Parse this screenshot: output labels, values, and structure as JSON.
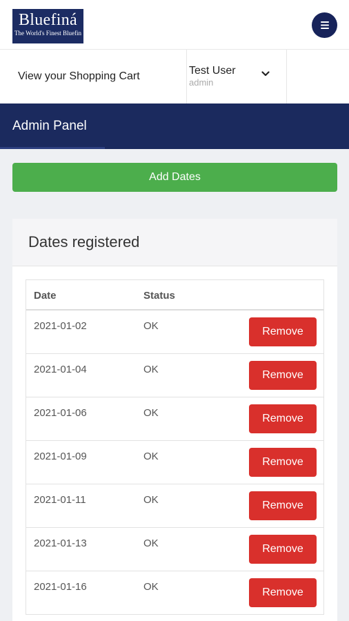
{
  "brand": {
    "name": "Bluefiná",
    "tagline": "The World's Finest Bluefin"
  },
  "header": {
    "menu_icon": "hamburger-menu-icon"
  },
  "nav": {
    "cart_label": "View your Shopping Cart",
    "user_name": "Test User",
    "user_role": "admin",
    "dropdown_icon": "chevron-down-icon"
  },
  "admin_panel": {
    "title": "Admin Panel"
  },
  "actions": {
    "add_dates_label": "Add Dates"
  },
  "dates_card": {
    "title": "Dates registered",
    "columns": [
      "Date",
      "Status"
    ],
    "remove_label": "Remove",
    "rows": [
      {
        "date": "2021-01-02",
        "status": "OK"
      },
      {
        "date": "2021-01-04",
        "status": "OK"
      },
      {
        "date": "2021-01-06",
        "status": "OK"
      },
      {
        "date": "2021-01-09",
        "status": "OK"
      },
      {
        "date": "2021-01-11",
        "status": "OK"
      },
      {
        "date": "2021-01-13",
        "status": "OK"
      },
      {
        "date": "2021-01-16",
        "status": "OK"
      }
    ]
  },
  "colors": {
    "navy": "#1b2a5e",
    "green": "#4cae4c",
    "red": "#d9302c",
    "page_bg": "#eef0f3"
  }
}
